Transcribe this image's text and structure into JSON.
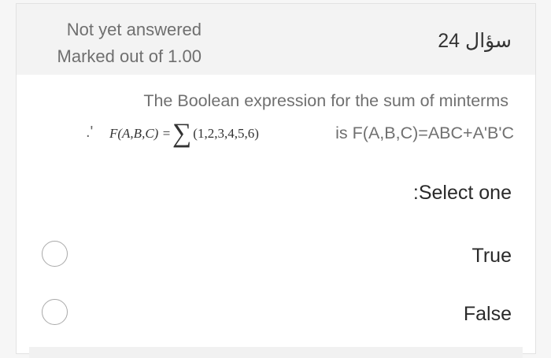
{
  "question": {
    "status": "Not yet answered",
    "marks": "Marked out of 1.00",
    "number_label": "سؤال 24",
    "text_line1": "The Boolean expression for the sum of minterms",
    "punct": ".'",
    "formula": {
      "lhs": "F(A,B,C) =",
      "sigma": "∑",
      "args": "(1,2,3,4,5,6)"
    },
    "text_line2": "is F(A,B,C)=ABC+A'B'C"
  },
  "answer": {
    "prompt": ":Select one",
    "options": [
      {
        "label": "True",
        "selected": false
      },
      {
        "label": "False",
        "selected": false
      }
    ]
  }
}
